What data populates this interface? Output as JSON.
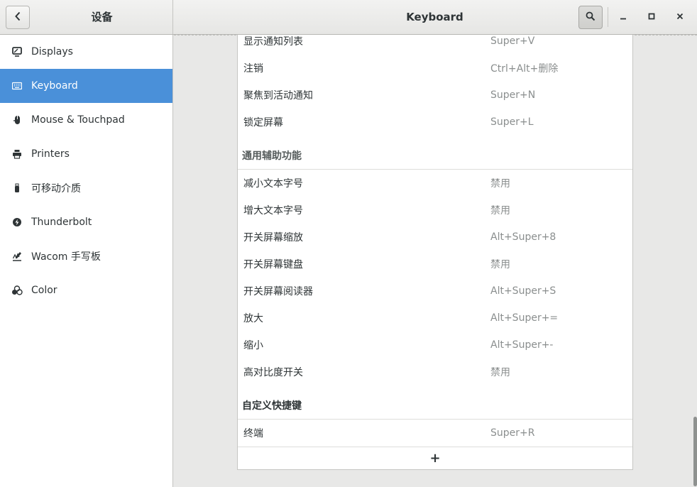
{
  "header": {
    "left_title": "设备",
    "title": "Keyboard"
  },
  "sidebar": {
    "items": [
      {
        "label": "Displays",
        "icon": "display-icon"
      },
      {
        "label": "Keyboard",
        "icon": "keyboard-icon",
        "active": true
      },
      {
        "label": "Mouse & Touchpad",
        "icon": "mouse-icon"
      },
      {
        "label": "Printers",
        "icon": "printer-icon"
      },
      {
        "label": "可移动介质",
        "icon": "usb-icon"
      },
      {
        "label": "Thunderbolt",
        "icon": "thunderbolt-icon"
      },
      {
        "label": "Wacom 手写板",
        "icon": "tablet-icon"
      },
      {
        "label": "Color",
        "icon": "color-icon"
      }
    ]
  },
  "shortcuts": {
    "system": [
      {
        "name": "显示通知列表",
        "key": "Super+V"
      },
      {
        "name": "注销",
        "key": "Ctrl+Alt+删除"
      },
      {
        "name": "聚焦到活动通知",
        "key": "Super+N"
      },
      {
        "name": "锁定屏幕",
        "key": "Super+L"
      }
    ],
    "accessibility_title": "通用辅助功能",
    "accessibility": [
      {
        "name": "减小文本字号",
        "key": "禁用"
      },
      {
        "name": "增大文本字号",
        "key": "禁用"
      },
      {
        "name": "开关屏幕缩放",
        "key": "Alt+Super+8"
      },
      {
        "name": "开关屏幕键盘",
        "key": "禁用"
      },
      {
        "name": "开关屏幕阅读器",
        "key": "Alt+Super+S"
      },
      {
        "name": "放大",
        "key": "Alt+Super+="
      },
      {
        "name": "缩小",
        "key": "Alt+Super+-"
      },
      {
        "name": "高对比度开关",
        "key": "禁用"
      }
    ],
    "custom_title": "自定义快捷键",
    "custom": [
      {
        "name": "终端",
        "key": "Super+R"
      }
    ],
    "add_label": "+"
  },
  "colors": {
    "accent": "#4a90d9"
  }
}
